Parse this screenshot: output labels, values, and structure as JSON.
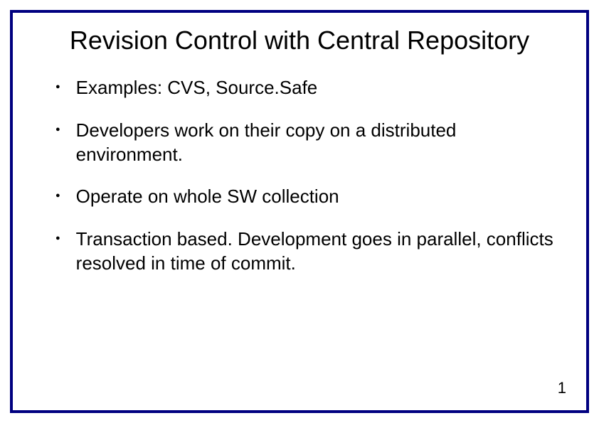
{
  "slide": {
    "title": "Revision Control with Central Repository",
    "bullets": [
      "Examples: CVS, Source.Safe",
      "Developers work on their copy on a distributed environment.",
      "Operate on whole SW collection",
      "Transaction based. Development goes in parallel, conflicts resolved in time of commit."
    ],
    "page_number": "1"
  }
}
